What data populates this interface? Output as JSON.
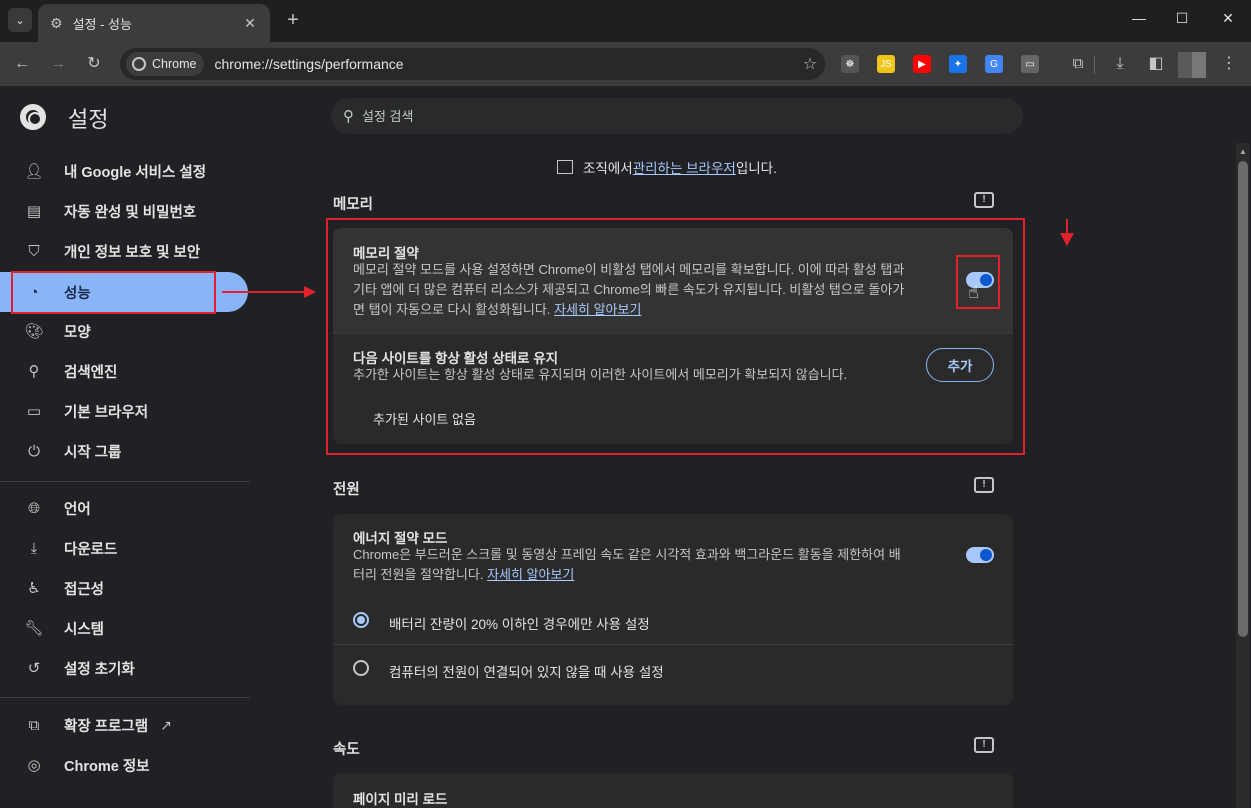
{
  "tab": {
    "title": "설정 - 성능",
    "close": "✕"
  },
  "window": {
    "minimize": "—",
    "maximize": "☐",
    "close": "✕"
  },
  "toolbar": {
    "chip_label": "Chrome",
    "url": "chrome://settings/performance"
  },
  "extensions": [
    {
      "name": "extension-icon-1",
      "color": "#555555",
      "glyph": "☸"
    },
    {
      "name": "js-extension-icon",
      "color": "#f0c419",
      "glyph": "JS"
    },
    {
      "name": "youtube-extension-icon",
      "color": "#ff0000",
      "glyph": "▶"
    },
    {
      "name": "extension-icon-4",
      "color": "#1a73e8",
      "glyph": "✦"
    },
    {
      "name": "translate-extension-icon",
      "color": "#4285f4",
      "glyph": "G"
    },
    {
      "name": "extension-icon-6",
      "color": "#666666",
      "glyph": "▭"
    }
  ],
  "settings": {
    "title": "설정",
    "search_placeholder": "설정 검색"
  },
  "sidebar": {
    "items": [
      {
        "label": "내 Google 서비스 설정"
      },
      {
        "label": "자동 완성 및 비밀번호"
      },
      {
        "label": "개인 정보 보호 및 보안"
      },
      {
        "label": "성능"
      },
      {
        "label": "모양"
      },
      {
        "label": "검색엔진"
      },
      {
        "label": "기본 브라우저"
      },
      {
        "label": "시작 그룹"
      },
      {
        "label": "언어"
      },
      {
        "label": "다운로드"
      },
      {
        "label": "접근성"
      },
      {
        "label": "시스템"
      },
      {
        "label": "설정 초기화"
      },
      {
        "label": "확장 프로그램"
      },
      {
        "label": "Chrome 정보"
      }
    ]
  },
  "managed": {
    "prefix": "조직에서 ",
    "link": "관리하는 브라우저",
    "suffix": "입니다."
  },
  "memory": {
    "section_title": "메모리",
    "saver_title": "메모리 절약",
    "saver_desc_1": "메모리 절약 모드를 사용 설정하면 Chrome이 비활성 탭에서 메모리를 확보합니다. 이에 따라 활성 탭과",
    "saver_desc_2": "기타 앱에 더 많은 컴퓨터 리소스가 제공되고 Chrome의 빠른 속도가 유지됩니다. 비활성 탭으로 돌아가",
    "saver_desc_3": "면 탭이 자동으로 다시 활성화됩니다. ",
    "learn_more": "자세히 알아보기",
    "always_active_title": "다음 사이트를 항상 활성 상태로 유지",
    "always_active_desc": "추가한 사이트는 항상 활성 상태로 유지되며 이러한 사이트에서 메모리가 확보되지 않습니다.",
    "add_button": "추가",
    "no_sites": "추가된 사이트 없음"
  },
  "power": {
    "section_title": "전원",
    "energy_title": "에너지 절약 모드",
    "energy_desc_1": "Chrome은 부드러운 스크롤 및 동영상 프레임 속도 같은 시각적 효과와 백그라운드 활동을 제한하여 배",
    "energy_desc_2": "터리 전원을 절약합니다. ",
    "learn_more": "자세히 알아보기",
    "option_1": "배터리 잔량이 20% 이하인 경우에만 사용 설정",
    "option_2": "컴퓨터의 전원이 연결되어 있지 않을 때 사용 설정"
  },
  "speed": {
    "section_title": "속도",
    "preload_title": "페이지 미리 로드"
  },
  "colors": {
    "annotation_red": "#e2222a",
    "accent": "#8ab4f8"
  }
}
